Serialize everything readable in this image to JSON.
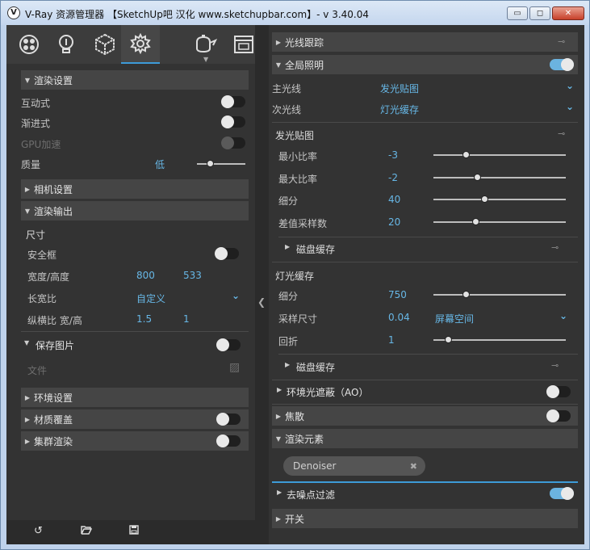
{
  "window": {
    "title": "V-Ray 资源管理器 【SketchUp吧 汉化 www.sketchupbar.com】- v 3.40.04",
    "icon_letter": "V",
    "min": "▭",
    "max": "◻",
    "close": "✕"
  },
  "toolbar": {
    "icons": [
      "materials-icon",
      "lights-icon",
      "geometry-icon",
      "settings-icon",
      "render-icon",
      "frame-buffer-icon"
    ],
    "active": "settings-icon"
  },
  "left": {
    "render_settings": {
      "header": "渲染设置",
      "interactive": "互动式",
      "progressive": "渐进式",
      "gpu": "GPU加速",
      "quality": "质量",
      "quality_value": "低"
    },
    "camera_settings": {
      "header": "相机设置"
    },
    "render_output": {
      "header": "渲染输出",
      "size": "尺寸",
      "safe_frame": "安全框",
      "width_height": "宽度/高度",
      "width": "800",
      "height": "533",
      "aspect": "长宽比",
      "aspect_value": "自定义",
      "ratio": "纵横比 宽/高",
      "ratio_w": "1.5",
      "ratio_h": "1"
    },
    "save_image": {
      "header": "保存图片",
      "file": "文件"
    },
    "environment": {
      "header": "环境设置"
    },
    "material_override": {
      "header": "材质覆盖"
    },
    "swarm": {
      "header": "集群渲染"
    }
  },
  "right": {
    "raytrace": {
      "header": "光线跟踪"
    },
    "gi": {
      "header": "全局照明",
      "primary": "主光线",
      "primary_value": "发光贴图",
      "secondary": "次光线",
      "secondary_value": "灯光缓存"
    },
    "irradiance": {
      "header": "发光贴图",
      "min_rate": "最小比率",
      "min_rate_value": "-3",
      "max_rate": "最大比率",
      "max_rate_value": "-2",
      "subdivs": "细分",
      "subdivs_value": "40",
      "interp": "差值采样数",
      "interp_value": "20",
      "disk_cache": "磁盘缓存"
    },
    "light_cache": {
      "header": "灯光缓存",
      "subdivs": "细分",
      "subdivs_value": "750",
      "sample_size": "采样尺寸",
      "sample_size_value": "0.04",
      "sample_space": "屏幕空间",
      "retrace": "回折",
      "retrace_value": "1",
      "disk_cache": "磁盘缓存"
    },
    "ao": {
      "header": "环境光遮蔽（AO）"
    },
    "caustics": {
      "header": "焦散"
    },
    "render_elements": {
      "header": "渲染元素",
      "chip": "Denoiser"
    },
    "denoiser": {
      "header": "去噪点过滤"
    },
    "switches": {
      "header": "开关"
    }
  },
  "colors": {
    "accent": "#3d9bd8",
    "value_text": "#67b7e6",
    "panel": "#333333",
    "section": "#454545"
  }
}
